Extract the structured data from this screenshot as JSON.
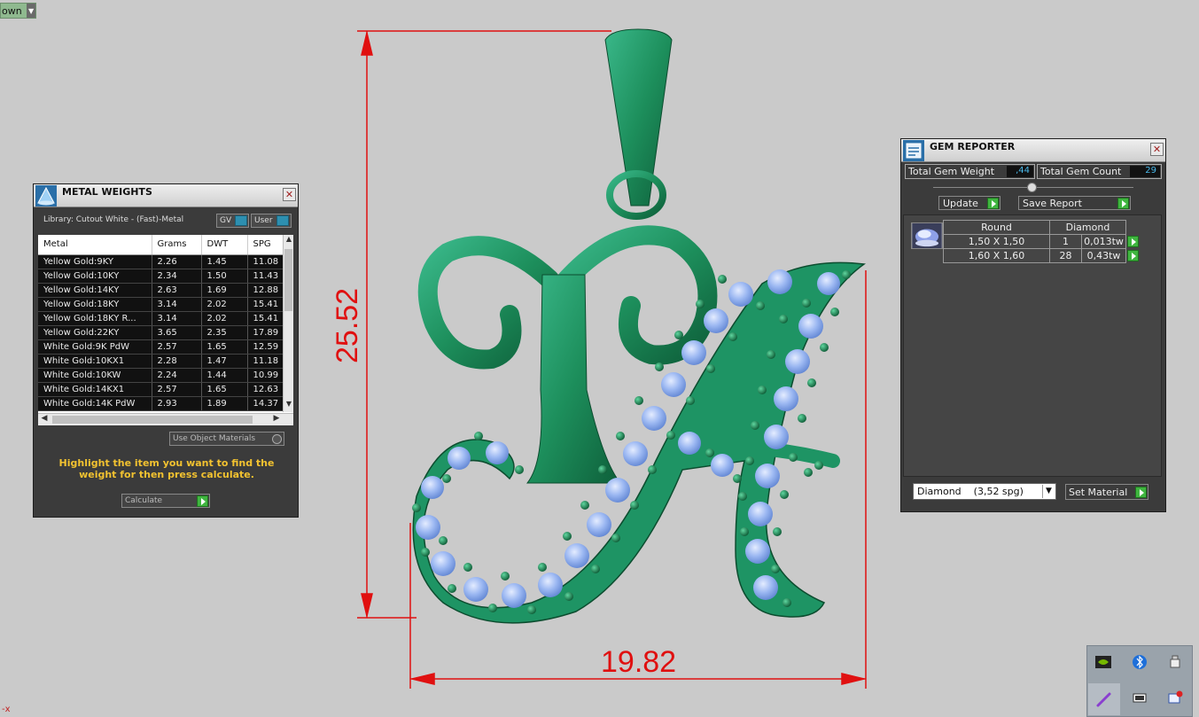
{
  "view_dropdown": {
    "label": "own"
  },
  "axis_mark": "-x",
  "dimensions": {
    "height": "25.52",
    "width": "19.82"
  },
  "metal_weights": {
    "title": "METAL WEIGHTS",
    "library": "Library: Cutout White - (Fast)-Metal",
    "gv_label": "GV",
    "user_label": "User",
    "columns": [
      "Metal",
      "Grams",
      "DWT",
      "SPG"
    ],
    "rows": [
      [
        "Yellow Gold:9KY",
        "2.26",
        "1.45",
        "11.08"
      ],
      [
        "Yellow Gold:10KY",
        "2.34",
        "1.50",
        "11.43"
      ],
      [
        "Yellow Gold:14KY",
        "2.63",
        "1.69",
        "12.88"
      ],
      [
        "Yellow Gold:18KY",
        "3.14",
        "2.02",
        "15.41"
      ],
      [
        "Yellow Gold:18KY R...",
        "3.14",
        "2.02",
        "15.41"
      ],
      [
        "Yellow Gold:22KY",
        "3.65",
        "2.35",
        "17.89"
      ],
      [
        "White Gold:9K PdW",
        "2.57",
        "1.65",
        "12.59"
      ],
      [
        "White Gold:10KX1",
        "2.28",
        "1.47",
        "11.18"
      ],
      [
        "White Gold:10KW",
        "2.24",
        "1.44",
        "10.99"
      ],
      [
        "White Gold:14KX1",
        "2.57",
        "1.65",
        "12.63"
      ],
      [
        "White Gold:14K PdW",
        "2.93",
        "1.89",
        "14.37"
      ]
    ],
    "use_object_materials": "Use Object Materials",
    "hint": "Highlight the item you want to find the weight for then press calculate.",
    "calculate_label": "Calculate"
  },
  "gem_reporter": {
    "title": "GEM REPORTER",
    "total_weight_label": "Total Gem Weight",
    "total_weight_value": ",44",
    "total_count_label": "Total Gem Count",
    "total_count_value": "29",
    "update_label": "Update",
    "save_report_label": "Save Report",
    "headers": [
      "Round",
      "Diamond"
    ],
    "rows": [
      [
        "1,50 X 1,50",
        "1",
        "0,013tw"
      ],
      [
        "1,60 X 1,60",
        "28",
        "0,43tw"
      ]
    ],
    "material_selected": "Diamond    (3,52 spg)",
    "set_material_label": "Set Material"
  },
  "colors": {
    "metal_green": "#1d8f5c",
    "gem_blue": "#8fb0f0",
    "dimension_red": "#e01010",
    "panel_bg": "#3b3b3b",
    "hint_yellow": "#f2c230",
    "value_blue": "#4ab8e8"
  },
  "tray_icons": [
    "nvidia-icon",
    "bluetooth-icon",
    "usb-icon",
    "pen-icon",
    "power-icon",
    "flag-icon"
  ]
}
